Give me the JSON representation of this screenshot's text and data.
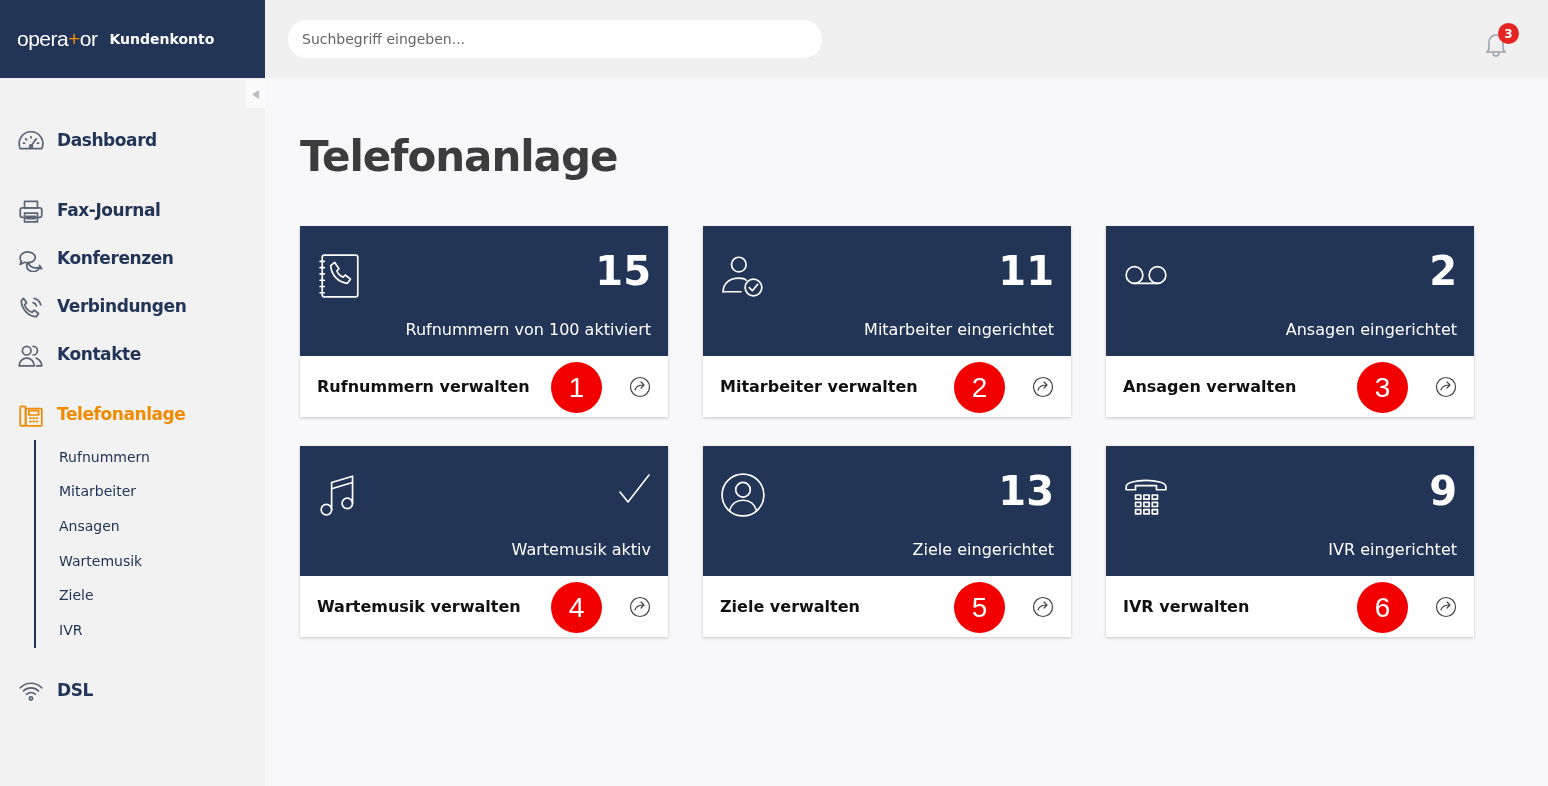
{
  "header": {
    "logo": {
      "before": "opera",
      "mark": "+",
      "after": "or"
    },
    "account_label": "Kundenkonto",
    "search": {
      "placeholder": "Suchbegriff eingeben..."
    },
    "notifications": {
      "count": "3"
    }
  },
  "sidebar": {
    "sections": [
      [
        {
          "label": "Dashboard",
          "selected": false
        }
      ],
      [
        {
          "label": "Fax-Journal",
          "selected": false
        },
        {
          "label": "Konferenzen",
          "selected": false
        },
        {
          "label": "Verbindungen",
          "selected": false
        },
        {
          "label": "Kontakte",
          "selected": false
        }
      ],
      [
        {
          "label": "Telefonanlage",
          "selected": true,
          "children": [
            {
              "label": "Rufnummern"
            },
            {
              "label": "Mitarbeiter"
            },
            {
              "label": "Ansagen"
            },
            {
              "label": "Wartemusik"
            },
            {
              "label": "Ziele"
            },
            {
              "label": "IVR"
            }
          ]
        }
      ],
      [
        {
          "label": "DSL",
          "selected": false
        }
      ]
    ]
  },
  "page": {
    "title": "Telefonanlage"
  },
  "cards": [
    {
      "kind": "count",
      "value": "15",
      "caption": "Rufnummern von 100 aktiviert",
      "action": "Rufnummern verwalten",
      "marker": "1"
    },
    {
      "kind": "count",
      "value": "11",
      "caption": "Mitarbeiter eingerichtet",
      "action": "Mitarbeiter verwalten",
      "marker": "2"
    },
    {
      "kind": "count",
      "value": "2",
      "caption": "Ansagen eingerichtet",
      "action": "Ansagen verwalten",
      "marker": "3"
    },
    {
      "kind": "status",
      "caption": "Wartemusik aktiv",
      "action": "Wartemusik verwalten",
      "marker": "4"
    },
    {
      "kind": "count",
      "value": "13",
      "caption": "Ziele eingerichtet",
      "action": "Ziele verwalten",
      "marker": "5"
    },
    {
      "kind": "count",
      "value": "9",
      "caption": "IVR eingerichtet",
      "action": "IVR verwalten",
      "marker": "6"
    }
  ]
}
